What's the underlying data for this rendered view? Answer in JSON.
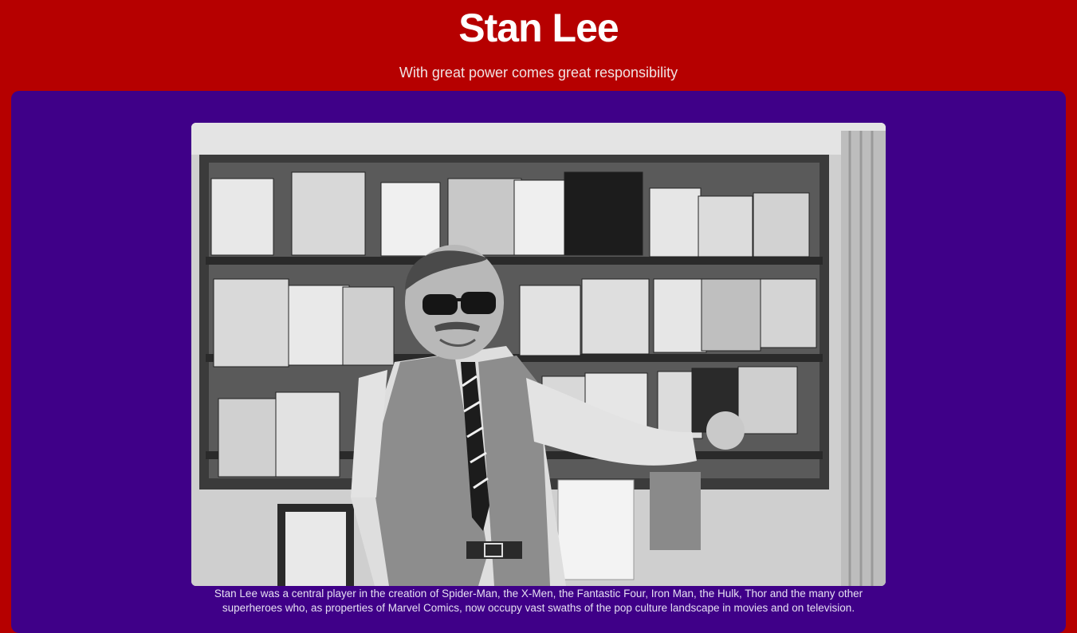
{
  "header": {
    "title": "Stan Lee",
    "subtitle": "With great power comes great responsibility"
  },
  "main": {
    "photo_alt": "Stan Lee pointing at a wall rack of comic books",
    "caption": "Stan Lee was a central player in the creation of Spider-Man, the X-Men, the Fantastic Four, Iron Man, the Hulk, Thor and the many other superheroes who, as properties of Marvel Comics, now occupy vast swaths of the pop culture landscape in movies and on television."
  },
  "colors": {
    "page_background": "#b60000",
    "panel_background": "#3f0088"
  }
}
